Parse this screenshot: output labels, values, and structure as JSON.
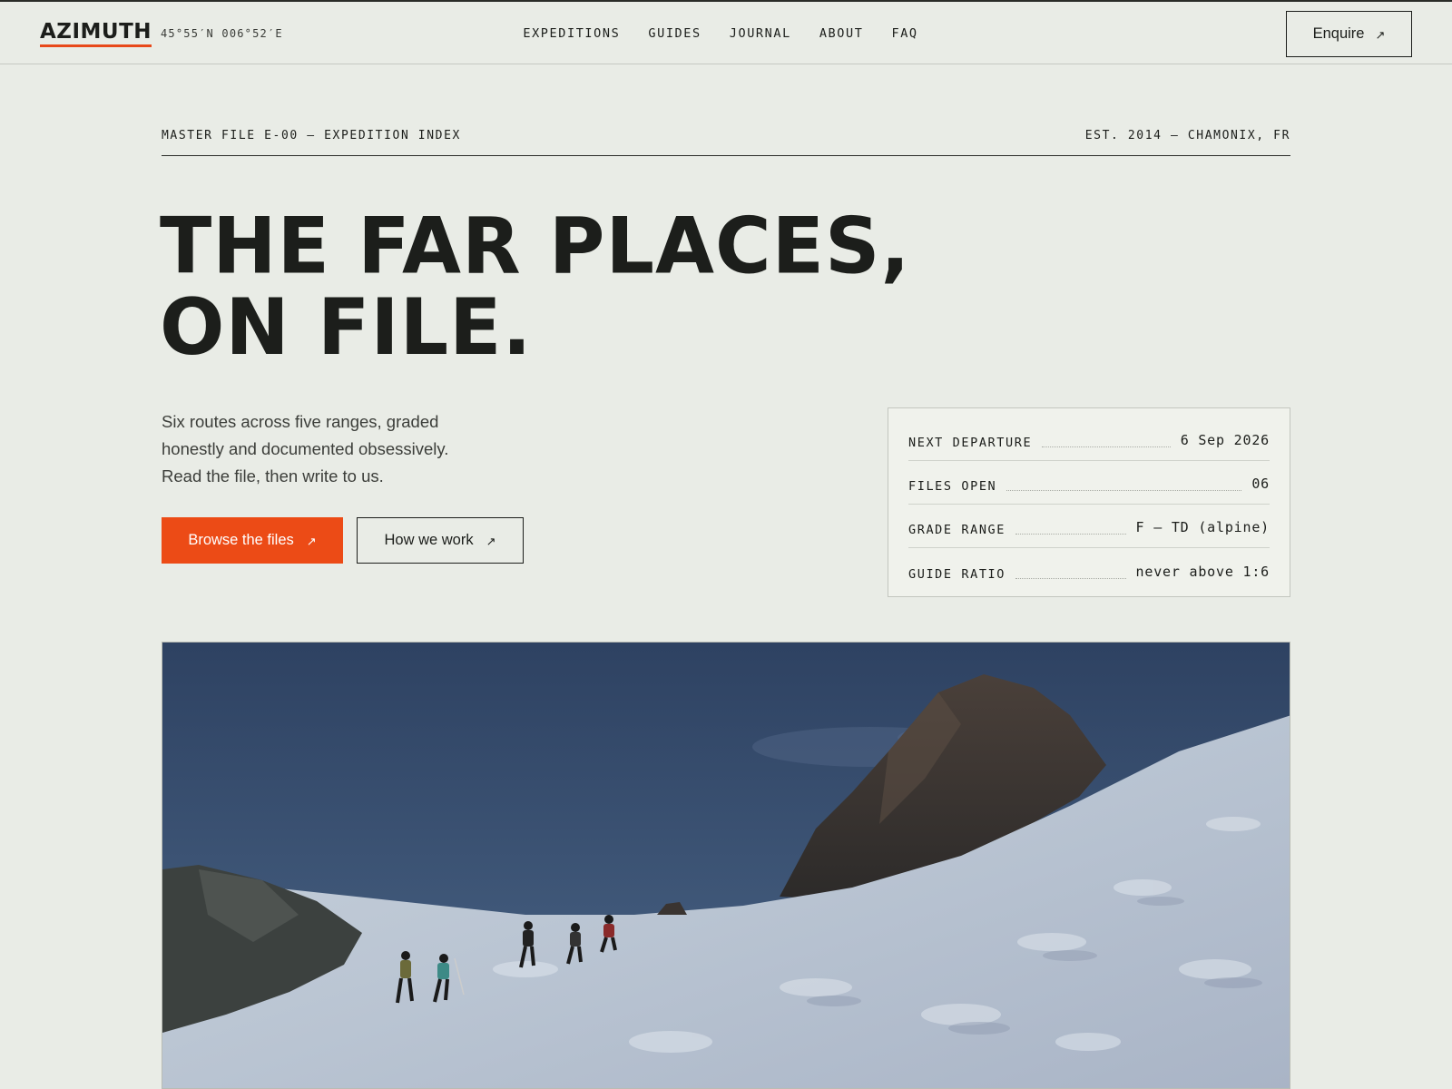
{
  "brand": {
    "name": "AZIMUTH",
    "coordinates": "45°55′N 006°52′E",
    "accent_color": "#ec4b16"
  },
  "nav": {
    "items": [
      {
        "label": "EXPEDITIONS"
      },
      {
        "label": "GUIDES"
      },
      {
        "label": "JOURNAL"
      },
      {
        "label": "ABOUT"
      },
      {
        "label": "FAQ"
      }
    ],
    "cta_label": "Enquire",
    "cta_icon": "arrow-up-right-icon"
  },
  "hero": {
    "file_label": "MASTER FILE E-00 — EXPEDITION INDEX",
    "established": "EST. 2014 — CHAMONIX, FR",
    "headline_line1": "THE FAR PLACES,",
    "headline_line2": "ON FILE.",
    "lede": "Six routes across five ranges, graded honestly and documented obsessively. Read the file, then write to us.",
    "primary_button": "Browse the files",
    "secondary_button": "How we work"
  },
  "spec_card": {
    "rows": [
      {
        "label": "NEXT DEPARTURE",
        "value": "6 Sep 2026"
      },
      {
        "label": "FILES OPEN",
        "value": "06"
      },
      {
        "label": "GRADE RANGE",
        "value": "F — TD (alpine)"
      },
      {
        "label": "GUIDE RATIO",
        "value": "never above 1:6"
      }
    ]
  }
}
